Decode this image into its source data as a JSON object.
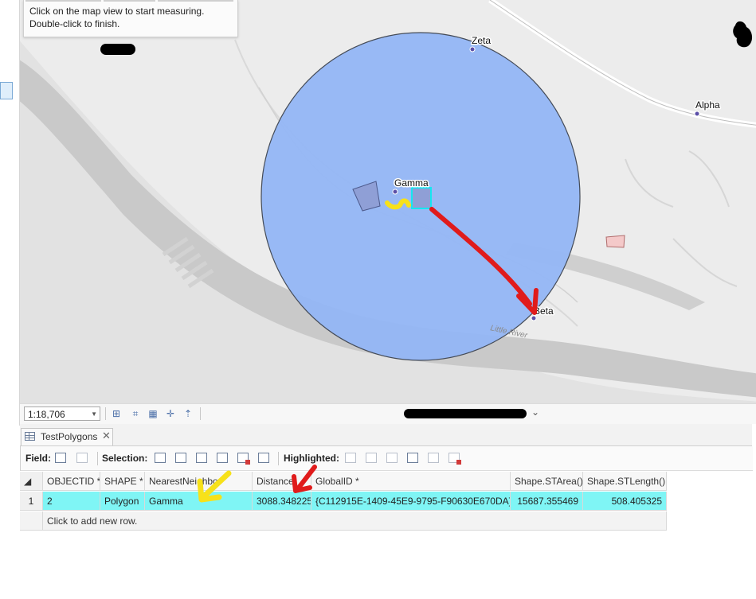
{
  "colors": {
    "buffer_fill": "#94b6f5",
    "buffer_stroke": "#444b57",
    "highlight_row": "#7ff5f5",
    "annotation_red": "#e01b1b",
    "annotation_yellow": "#f7e11a"
  },
  "measure_tooltip": {
    "line1": "Click on the map view to start measuring.",
    "line2": "Double-click to finish."
  },
  "map": {
    "points": [
      {
        "label": "Zeta"
      },
      {
        "label": "Alpha"
      },
      {
        "label": "Gamma"
      },
      {
        "label": "Beta"
      }
    ],
    "river_label": "Little River"
  },
  "status_bar": {
    "scale": "1:18,706",
    "icons": [
      "add-grid-icon",
      "measure-grid-icon",
      "table-grid-icon",
      "snapping-icon",
      "north-arrow-icon"
    ]
  },
  "attribute_table": {
    "tab_label": "TestPolygons",
    "tab_close": "✕",
    "toolbar": {
      "field_label": "Field:",
      "selection_label": "Selection:",
      "highlighted_label": "Highlighted:"
    },
    "columns": [
      "OBJECTID *",
      "SHAPE *",
      "NearestNeighbor",
      "Distance",
      "GlobalID *",
      "Shape.STArea()",
      "Shape.STLength()"
    ],
    "rows": [
      {
        "row_number": "1",
        "objectid": "2",
        "shape": "Polygon",
        "nearest": "Gamma",
        "distance": "3088.348225",
        "globalid": "{C112915E-1409-45E9-9795-F90630E670DA}",
        "area": "15687.355469",
        "length": "508.405325"
      }
    ],
    "add_row_text": "Click to add new row."
  }
}
